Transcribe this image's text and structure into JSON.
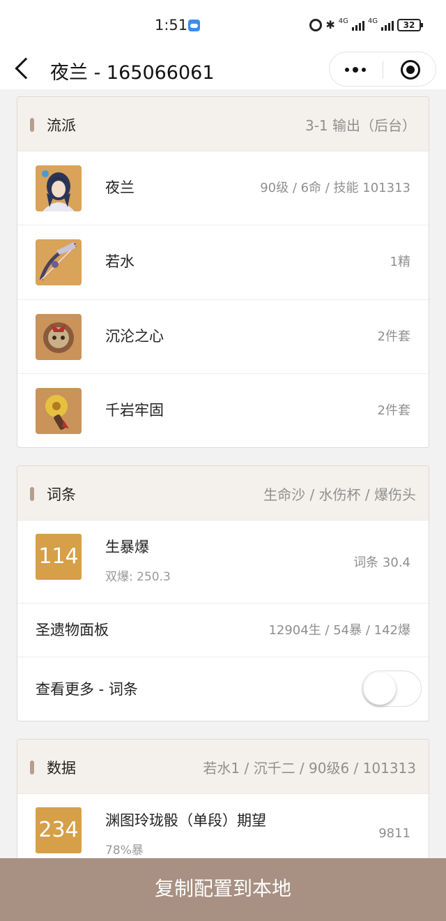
{
  "status": {
    "time": "1:51",
    "sig1": "4G",
    "sig2": "4G",
    "battery": "32"
  },
  "nav": {
    "title": "夜兰 - 165066061"
  },
  "build": {
    "title": "流派",
    "subtitle": "3-1 输出（后台）",
    "rows": [
      {
        "name": "夜兰",
        "value": "90级 / 6命 / 技能 101313",
        "icon": "character-portrait"
      },
      {
        "name": "若水",
        "value": "1精",
        "icon": "bow-weapon"
      },
      {
        "name": "沉沦之心",
        "value": "2件套",
        "icon": "artifact-mask"
      },
      {
        "name": "千岩牢固",
        "value": "2件套",
        "icon": "artifact-flower"
      }
    ]
  },
  "substats": {
    "title": "词条",
    "subtitle": "生命沙 / 水伤杯 / 爆伤头",
    "score": "114",
    "stat_name": "生暴爆",
    "stat_sub": "双爆: 250.3",
    "stat_value": "词条 30.4",
    "panel_label": "圣遗物面板",
    "panel_value": "12904生 / 54暴 / 142爆",
    "more_label": "查看更多 - 词条",
    "more_toggle": false
  },
  "data": {
    "title": "数据",
    "subtitle": "若水1 / 沉千二 / 90级6 / 101313",
    "score": "234",
    "stat_name": "渊图玲珑骰（单段）期望",
    "stat_sub": "78%暴",
    "stat_value": "9811"
  },
  "bottom": {
    "button": "复制配置到本地"
  },
  "colors": {
    "accent": "#a89082",
    "score": "#d6a048",
    "header_bg": "#f4f1ec"
  }
}
